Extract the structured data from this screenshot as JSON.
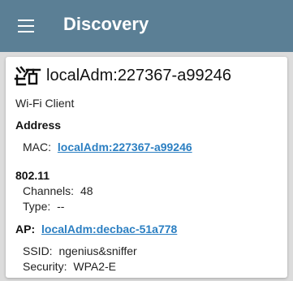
{
  "app_bar": {
    "title": "Discovery",
    "menu_icon": "hamburger-menu-icon",
    "background": "#5b7f95"
  },
  "device": {
    "icon": "wifi-client-device-icon",
    "name": "localAdm:227367-a99246",
    "type": "Wi-Fi Client"
  },
  "address": {
    "heading": "Address",
    "mac_label": "MAC:",
    "mac_value": "localAdm:227367-a99246"
  },
  "wireless": {
    "heading": "802.11",
    "channels_label": "Channels:",
    "channels_value": "48",
    "type_label": "Type:",
    "type_value": "--"
  },
  "ap": {
    "label": "AP:",
    "value": "localAdm:decbac-51a778",
    "ssid_label": "SSID:",
    "ssid_value": "ngenius&sniffer",
    "security_label": "Security:",
    "security_value": "WPA2-E"
  },
  "colors": {
    "link": "#2b7fc2",
    "text": "#222222",
    "card": "#ffffff",
    "page_bg": "#dcdcdc"
  }
}
